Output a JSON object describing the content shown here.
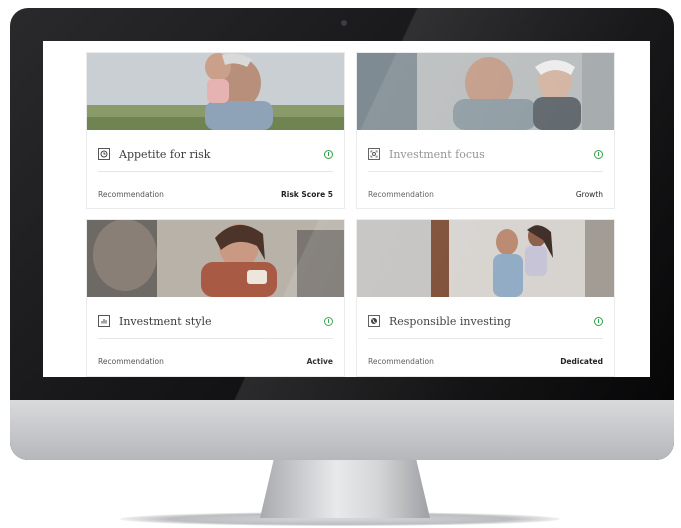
{
  "cards": [
    {
      "id": "risk",
      "icon": "clock-icon",
      "title": "Appetite for risk",
      "rec_label": "Recommendation",
      "rec_value": "Risk Score 5"
    },
    {
      "id": "focus",
      "icon": "target-icon",
      "title": "Investment focus",
      "rec_label": "Recommendation",
      "rec_value": "Growth"
    },
    {
      "id": "style",
      "icon": "bar-chart-icon",
      "title": "Investment style",
      "rec_label": "Recommendation",
      "rec_value": "Active"
    },
    {
      "id": "responsible",
      "icon": "globe-icon",
      "title": "Responsible investing",
      "rec_label": "Recommendation",
      "rec_value": "Dedicated"
    }
  ],
  "colors": {
    "accent_green": "#2e9e49",
    "text_dark": "#222222",
    "divider": "#e6e6e6"
  }
}
